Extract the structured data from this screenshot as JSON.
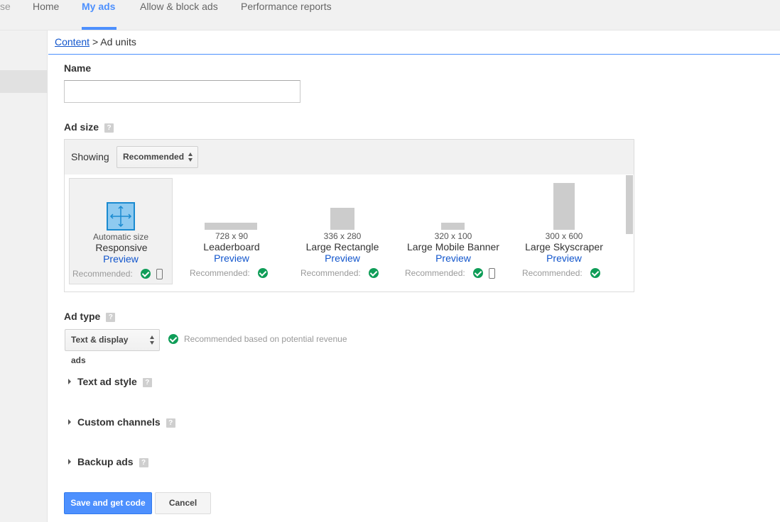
{
  "nav": {
    "partial": "se",
    "items": [
      {
        "label": "Home"
      },
      {
        "label": "My ads"
      },
      {
        "label": "Allow & block ads"
      },
      {
        "label": "Performance reports"
      }
    ]
  },
  "breadcrumb": {
    "link": "Content",
    "separator": ">",
    "current": "Ad units"
  },
  "form": {
    "name_label": "Name",
    "name_value": "",
    "ad_size_label": "Ad size",
    "help_glyph": "?",
    "showing_label": "Showing",
    "showing_value": "Recommended",
    "sizes": [
      {
        "dims": "Automatic size",
        "title": "Responsive",
        "preview": "Preview",
        "rec": "Recommended:",
        "mobile": true
      },
      {
        "dims": "728 x 90",
        "title": "Leaderboard",
        "preview": "Preview",
        "rec": "Recommended:",
        "mobile": false
      },
      {
        "dims": "336 x 280",
        "title": "Large Rectangle",
        "preview": "Preview",
        "rec": "Recommended:",
        "mobile": false
      },
      {
        "dims": "320 x 100",
        "title": "Large Mobile Banner",
        "preview": "Preview",
        "rec": "Recommended:",
        "mobile": true
      },
      {
        "dims": "300 x 600",
        "title": "Large Skyscraper",
        "preview": "Preview",
        "rec": "Recommended:",
        "mobile": false
      }
    ],
    "ad_type_label": "Ad type",
    "ad_type_value": "Text & display ads",
    "ad_type_note": "Recommended based on potential revenue",
    "sections": [
      "Text ad style",
      "Custom channels",
      "Backup ads"
    ],
    "save_label": "Save and get code",
    "cancel_label": "Cancel"
  },
  "colors": {
    "accent": "#4d90fe",
    "link": "#1155cc",
    "check": "#0f9d58"
  }
}
